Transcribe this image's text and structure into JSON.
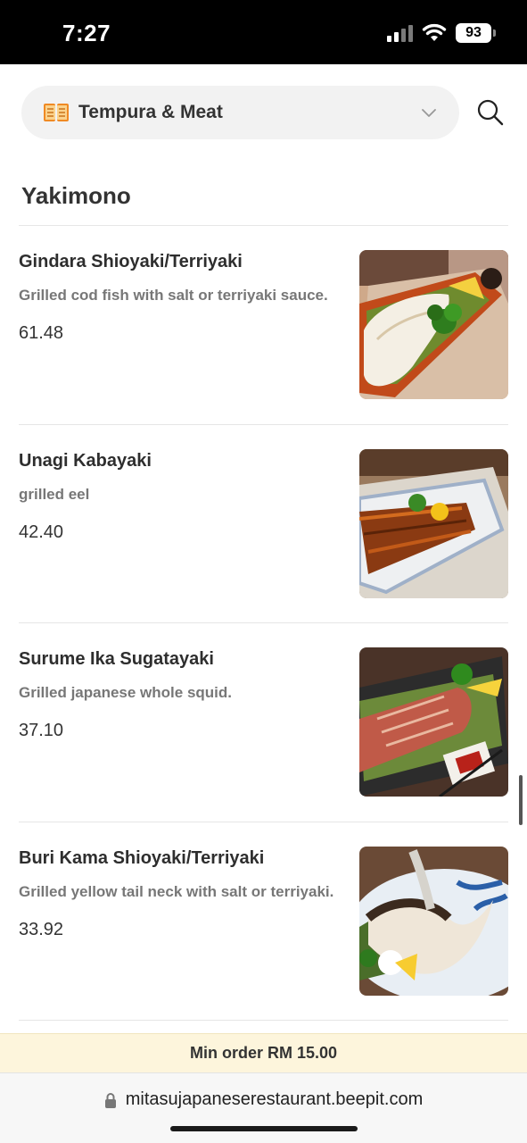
{
  "status_bar": {
    "time": "7:27",
    "battery": "93"
  },
  "header": {
    "category": "Tempura & Meat"
  },
  "section": {
    "title": "Yakimono"
  },
  "items": [
    {
      "name": "Gindara Shioyaki/Terriyaki",
      "description": "Grilled cod fish with salt or terriyaki sauce.",
      "price": "61.48"
    },
    {
      "name": "Unagi Kabayaki",
      "description": "grilled eel",
      "price": "42.40"
    },
    {
      "name": "Surume Ika Sugatayaki",
      "description": "Grilled japanese whole squid.",
      "price": "37.10"
    },
    {
      "name": "Buri Kama Shioyaki/Terriyaki",
      "description": "Grilled yellow tail neck with salt or terriyaki.",
      "price": "33.92"
    }
  ],
  "footer": {
    "min_order": "Min order RM 15.00"
  },
  "browser": {
    "url": "mitasujapaneserestaurant.beepit.com"
  },
  "colors": {
    "accent_book": "#f08a24",
    "min_order_bg": "#fdf5dc"
  },
  "icons": [
    "book-icon",
    "chevron-down-icon",
    "search-icon",
    "lock-icon",
    "wifi-icon",
    "signal-icon",
    "battery-icon"
  ]
}
